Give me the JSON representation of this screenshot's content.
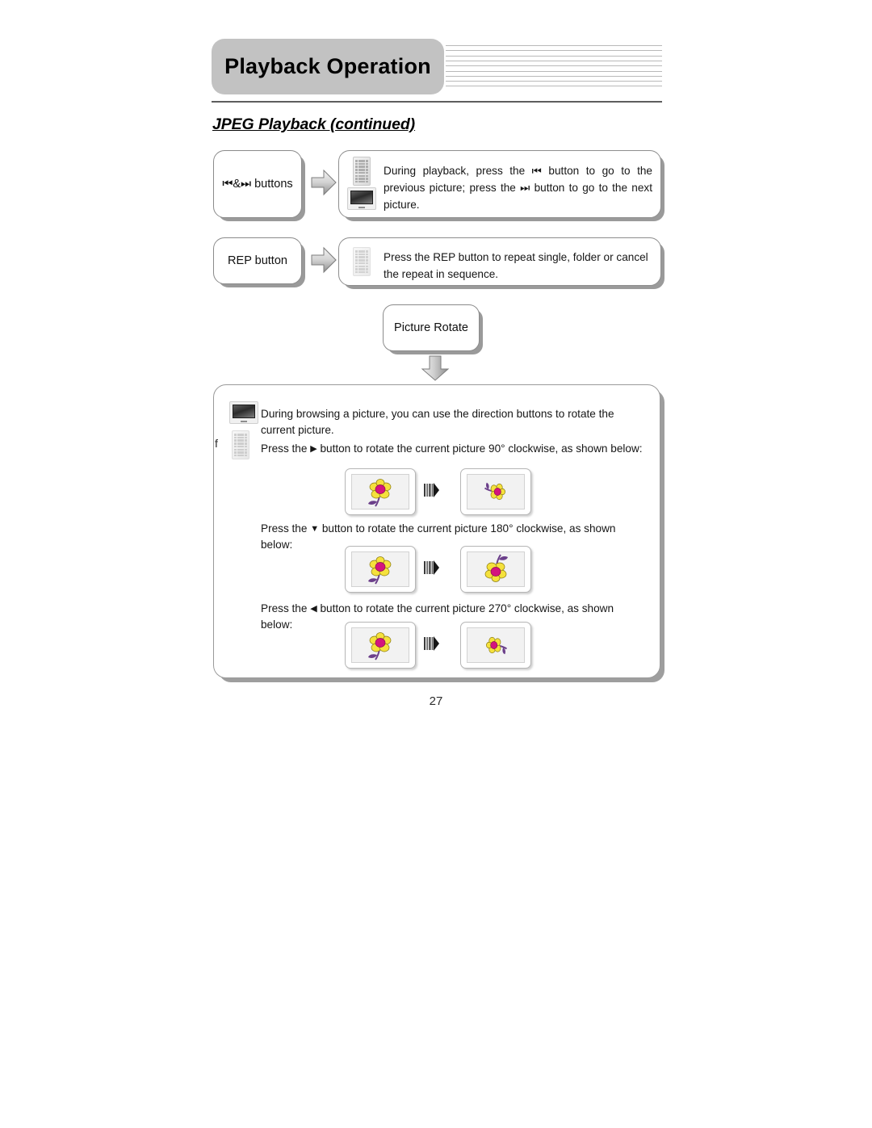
{
  "header": {
    "title": "Playback Operation",
    "decorative_line_count": 9,
    "rule_color": "#5d5d5d",
    "pill_color": "#c2c2c2"
  },
  "subtitle": "JPEG Playback (continued)",
  "rows": [
    {
      "label": "⏮&⏭ buttons",
      "label_name": "prev-next-buttons-label",
      "description": "During playback, press the ⏮ button to go to the previous picture; press the ⏭ button to go to the next picture.",
      "icons": [
        "remote-control-icon",
        "tv-icon"
      ]
    },
    {
      "label": "REP button",
      "label_name": "rep-button-label",
      "description": "Press the REP button to repeat single, folder or cancel the repeat in sequence.",
      "icons": [
        "remote-control-icon"
      ]
    }
  ],
  "rotate_node": {
    "label": "Picture Rotate"
  },
  "main_panel": {
    "stray_char": "f",
    "intro": "During browsing a picture, you can use the direction buttons to rotate the current picture.",
    "icons": [
      "tv-icon",
      "remote-control-icon"
    ],
    "steps": [
      {
        "prefix": "Press the",
        "button_glyph": "▶",
        "button_direction": "right",
        "suffix": "button to rotate the current picture 90° clockwise, as shown below:",
        "angle": 90,
        "before_alt": "flower upright",
        "after_alt": "flower rotated 90 degrees clockwise"
      },
      {
        "prefix": "Press the",
        "button_glyph": "▼",
        "button_direction": "down",
        "suffix": "button to rotate the current picture 180° clockwise, as shown below:",
        "angle": 180,
        "before_alt": "flower upright",
        "after_alt": "flower rotated 180 degrees"
      },
      {
        "prefix": "Press the",
        "button_glyph": "◀",
        "button_direction": "left",
        "suffix": "button to rotate the current picture 270° clockwise, as shown below:",
        "angle": 270,
        "before_alt": "flower upright",
        "after_alt": "flower rotated 270 degrees clockwise"
      }
    ]
  },
  "page_number": "27",
  "colors": {
    "flower_petal": "#f5e13c",
    "flower_center": "#d4147e",
    "flower_stem": "#6b3f8a",
    "arrow_gray_light": "#efefef",
    "arrow_gray_dark": "#8c8c8c"
  }
}
